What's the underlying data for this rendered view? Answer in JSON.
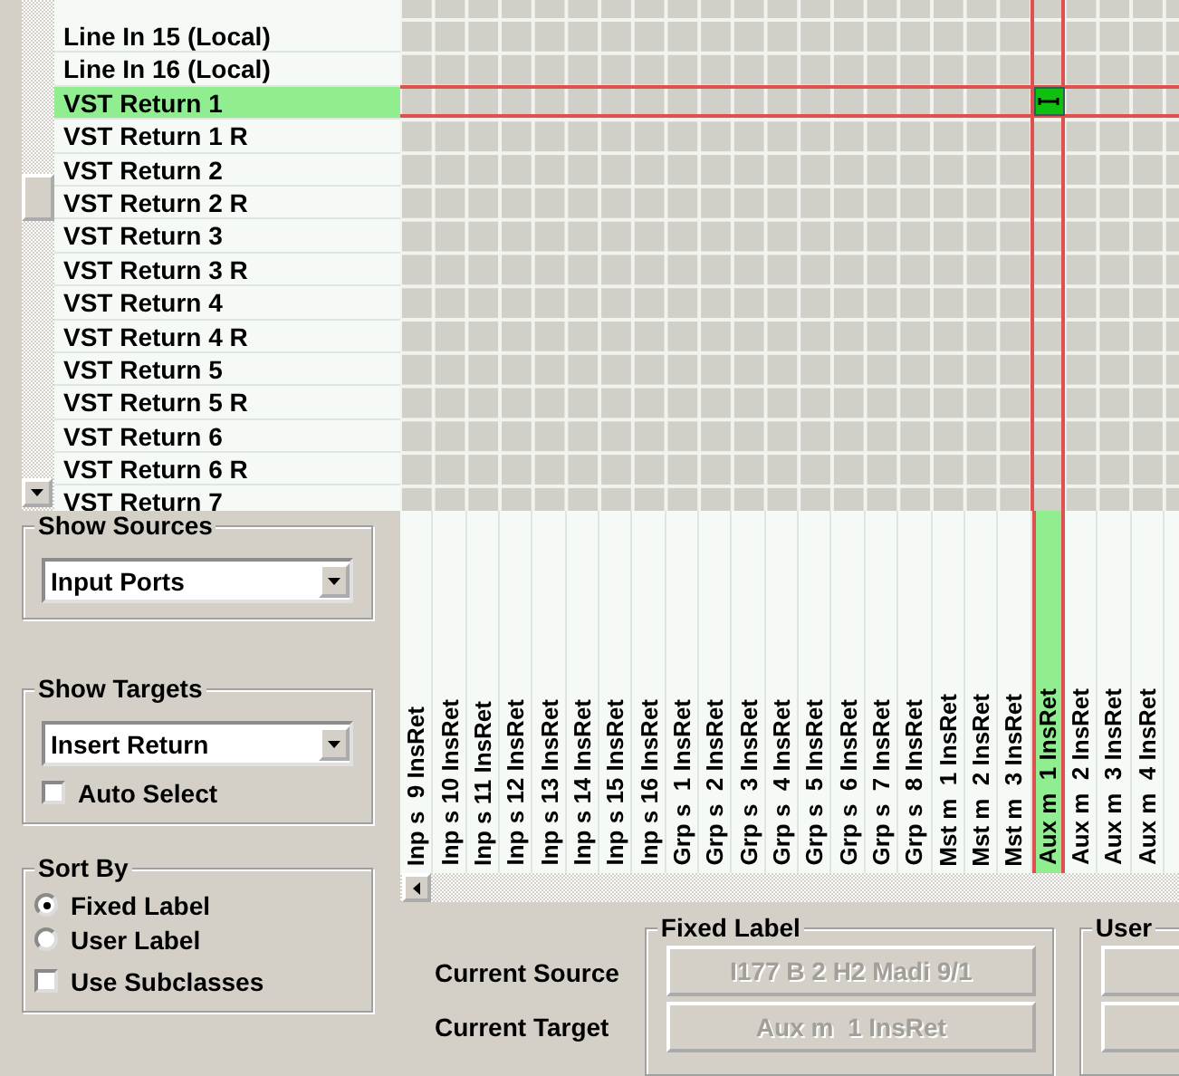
{
  "sources": [
    {
      "label": "Line In 15 (Local)",
      "selected": false,
      "connected": false
    },
    {
      "label": "Line In 16 (Local)",
      "selected": false,
      "connected": false
    },
    {
      "label": "VST Return 1",
      "selected": true,
      "connected": true
    },
    {
      "label": "VST Return 1 R",
      "selected": false,
      "connected": false
    },
    {
      "label": "VST Return 2",
      "selected": false,
      "connected": false
    },
    {
      "label": "VST Return 2 R",
      "selected": false,
      "connected": false
    },
    {
      "label": "VST Return 3",
      "selected": false,
      "connected": false
    },
    {
      "label": "VST Return 3 R",
      "selected": false,
      "connected": false
    },
    {
      "label": "VST Return 4",
      "selected": false,
      "connected": false
    },
    {
      "label": "VST Return 4 R",
      "selected": false,
      "connected": false
    },
    {
      "label": "VST Return 5",
      "selected": false,
      "connected": false
    },
    {
      "label": "VST Return 5 R",
      "selected": false,
      "connected": false
    },
    {
      "label": "VST Return 6",
      "selected": false,
      "connected": false
    },
    {
      "label": "VST Return 6 R",
      "selected": false,
      "connected": false
    },
    {
      "label": "VST Return 7",
      "selected": false,
      "connected": false
    }
  ],
  "targets": [
    {
      "label": "Inp s  9 InsRet",
      "selected": false,
      "connected": false
    },
    {
      "label": "Inp s 10 InsRet",
      "selected": false,
      "connected": false
    },
    {
      "label": "Inp s 11 InsRet",
      "selected": false,
      "connected": false
    },
    {
      "label": "Inp s 12 InsRet",
      "selected": false,
      "connected": false
    },
    {
      "label": "Inp s 13 InsRet",
      "selected": false,
      "connected": false
    },
    {
      "label": "Inp s 14 InsRet",
      "selected": false,
      "connected": false
    },
    {
      "label": "Inp s 15 InsRet",
      "selected": false,
      "connected": false
    },
    {
      "label": "Inp s 16 InsRet",
      "selected": false,
      "connected": false
    },
    {
      "label": "Grp s  1 InsRet",
      "selected": false,
      "connected": false
    },
    {
      "label": "Grp s  2 InsRet",
      "selected": false,
      "connected": false
    },
    {
      "label": "Grp s  3 InsRet",
      "selected": false,
      "connected": false
    },
    {
      "label": "Grp s  4 InsRet",
      "selected": false,
      "connected": false
    },
    {
      "label": "Grp s  5 InsRet",
      "selected": false,
      "connected": false
    },
    {
      "label": "Grp s  6 InsRet",
      "selected": false,
      "connected": false
    },
    {
      "label": "Grp s  7 InsRet",
      "selected": false,
      "connected": false
    },
    {
      "label": "Grp s  8 InsRet",
      "selected": false,
      "connected": false
    },
    {
      "label": "Mst m  1 InsRet",
      "selected": false,
      "connected": false
    },
    {
      "label": "Mst m  2 InsRet",
      "selected": false,
      "connected": false
    },
    {
      "label": "Mst m  3 InsRet",
      "selected": false,
      "connected": false
    },
    {
      "label": "Aux m  1 InsRet",
      "selected": true,
      "connected": true
    },
    {
      "label": "Aux m  2 InsRet",
      "selected": false,
      "connected": false
    },
    {
      "label": "Aux m  3 InsRet",
      "selected": false,
      "connected": false
    },
    {
      "label": "Aux m  4 InsRet",
      "selected": false,
      "connected": false
    }
  ],
  "show_sources": {
    "title": "Show Sources",
    "value": "Input Ports"
  },
  "show_targets": {
    "title": "Show Targets",
    "value": "Insert Return",
    "auto_select": {
      "label": "Auto Select",
      "checked": false
    }
  },
  "sort_by": {
    "title": "Sort By",
    "options": [
      {
        "label": "Fixed Label",
        "selected": true
      },
      {
        "label": "User Label",
        "selected": false
      }
    ],
    "use_subclasses": {
      "label": "Use Subclasses",
      "checked": false
    }
  },
  "current": {
    "source_label": "Current Source",
    "target_label": "Current Target"
  },
  "fixed_label": {
    "title": "Fixed Label",
    "source": "I177 B 2 H2 Madi 9/1",
    "target": "Aux m  1 InsRet",
    "disabled": true
  },
  "user_label": {
    "title": "User"
  }
}
